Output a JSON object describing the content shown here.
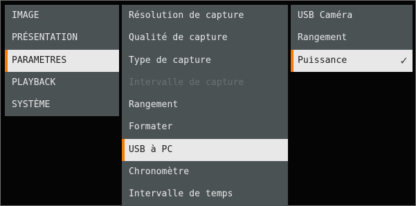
{
  "menu": {
    "column1": [
      {
        "label": "IMAGE",
        "state": "normal"
      },
      {
        "label": "PRÉSENTATION",
        "state": "normal"
      },
      {
        "label": "PARAMETRES",
        "state": "selected"
      },
      {
        "label": "PLAYBACK",
        "state": "normal"
      },
      {
        "label": "SYSTÈME",
        "state": "normal"
      }
    ],
    "column2": [
      {
        "label": "Résolution de capture",
        "state": "normal"
      },
      {
        "label": "Qualité de capture",
        "state": "normal"
      },
      {
        "label": "Type de capture",
        "state": "normal"
      },
      {
        "label": "Intervalle de capture",
        "state": "disabled"
      },
      {
        "label": "Rangement",
        "state": "normal"
      },
      {
        "label": "Formater",
        "state": "normal"
      },
      {
        "label": "USB à PC",
        "state": "selected"
      },
      {
        "label": "Chronomètre",
        "state": "normal"
      },
      {
        "label": "Intervalle de temps",
        "state": "normal"
      }
    ],
    "column3": [
      {
        "label": "USB Caméra",
        "state": "normal"
      },
      {
        "label": "Rangement",
        "state": "normal"
      },
      {
        "label": "Puissance",
        "state": "selected",
        "checked": true,
        "check_icon": "checkmark-icon"
      }
    ]
  },
  "colors": {
    "item_bg": "#4b5254",
    "selected_bg": "#e8e8e8",
    "accent": "#f07c00",
    "text": "#e9e9e9",
    "disabled_text": "#6c7274"
  }
}
